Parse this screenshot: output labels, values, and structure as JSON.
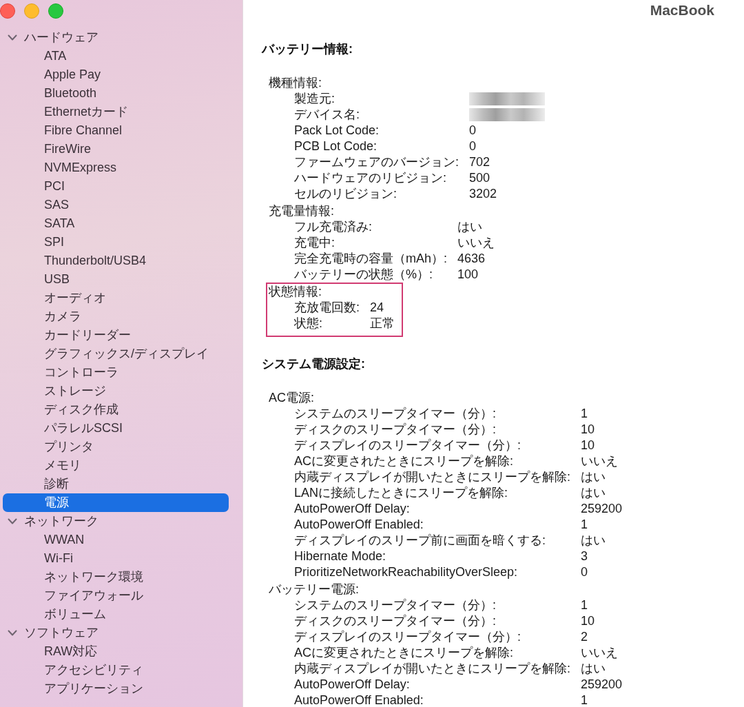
{
  "window": {
    "title": "MacBook",
    "controls": [
      {
        "kind": "close"
      },
      {
        "kind": "minimize"
      },
      {
        "kind": "zoom"
      }
    ]
  },
  "sidebar": {
    "groups": [
      {
        "label": "ハードウェア",
        "expanded": true,
        "children": [
          {
            "label": "ATA",
            "selected": false
          },
          {
            "label": "Apple Pay",
            "selected": false
          },
          {
            "label": "Bluetooth",
            "selected": false
          },
          {
            "label": "Ethernetカード",
            "selected": false
          },
          {
            "label": "Fibre Channel",
            "selected": false
          },
          {
            "label": "FireWire",
            "selected": false
          },
          {
            "label": "NVMExpress",
            "selected": false
          },
          {
            "label": "PCI",
            "selected": false
          },
          {
            "label": "SAS",
            "selected": false
          },
          {
            "label": "SATA",
            "selected": false
          },
          {
            "label": "SPI",
            "selected": false
          },
          {
            "label": "Thunderbolt/USB4",
            "selected": false
          },
          {
            "label": "USB",
            "selected": false
          },
          {
            "label": "オーディオ",
            "selected": false
          },
          {
            "label": "カメラ",
            "selected": false
          },
          {
            "label": "カードリーダー",
            "selected": false
          },
          {
            "label": "グラフィックス/ディスプレイ",
            "selected": false
          },
          {
            "label": "コントローラ",
            "selected": false
          },
          {
            "label": "ストレージ",
            "selected": false
          },
          {
            "label": "ディスク作成",
            "selected": false
          },
          {
            "label": "パラレルSCSI",
            "selected": false
          },
          {
            "label": "プリンタ",
            "selected": false
          },
          {
            "label": "メモリ",
            "selected": false
          },
          {
            "label": "診断",
            "selected": false
          },
          {
            "label": "電源",
            "selected": true
          }
        ]
      },
      {
        "label": "ネットワーク",
        "expanded": true,
        "children": [
          {
            "label": "WWAN",
            "selected": false
          },
          {
            "label": "Wi-Fi",
            "selected": false
          },
          {
            "label": "ネットワーク環境",
            "selected": false
          },
          {
            "label": "ファイアウォール",
            "selected": false
          },
          {
            "label": "ボリューム",
            "selected": false
          }
        ]
      },
      {
        "label": "ソフトウェア",
        "expanded": true,
        "children": [
          {
            "label": "RAW対応",
            "selected": false
          },
          {
            "label": "アクセシビリティ",
            "selected": false
          },
          {
            "label": "アプリケーション",
            "selected": false
          }
        ]
      }
    ]
  },
  "report": {
    "sections": [
      {
        "title": "バッテリー情報:",
        "groups": [
          {
            "label": "機種情報:",
            "highlighted": false,
            "rows": [
              {
                "key": "製造元:",
                "redacted": true
              },
              {
                "key": "デバイス名:",
                "redacted": true
              },
              {
                "key": "Pack Lot Code:",
                "value": "0",
                "redacted": false
              },
              {
                "key": "PCB Lot Code:",
                "value": "0",
                "redacted": false
              },
              {
                "key": "ファームウェアのバージョン:",
                "value": "702",
                "redacted": false
              },
              {
                "key": "ハードウェアのリビジョン:",
                "value": "500",
                "redacted": false
              },
              {
                "key": "セルのリビジョン:",
                "value": "3202",
                "redacted": false
              }
            ]
          },
          {
            "label": "充電量情報:",
            "highlighted": false,
            "rows": [
              {
                "key": "フル充電済み:",
                "value": "はい"
              },
              {
                "key": "充電中:",
                "value": "いいえ"
              },
              {
                "key": "完全充電時の容量（mAh）:",
                "value": "4636"
              },
              {
                "key": "バッテリーの状態（%）:",
                "value": "100"
              }
            ]
          },
          {
            "label": "状態情報:",
            "highlighted": true,
            "rows": [
              {
                "key": "充放電回数:",
                "value": "24"
              },
              {
                "key": "状態:",
                "value": "正常"
              }
            ]
          }
        ]
      },
      {
        "title": "システム電源設定:",
        "groups": [
          {
            "label": "AC電源:",
            "highlighted": false,
            "rows": [
              {
                "key": "システムのスリープタイマー（分）:",
                "value": "1"
              },
              {
                "key": "ディスクのスリープタイマー（分）:",
                "value": "10"
              },
              {
                "key": "ディスプレイのスリープタイマー（分）:",
                "value": "10"
              },
              {
                "key": "ACに変更されたときにスリープを解除:",
                "value": "いいえ"
              },
              {
                "key": "内蔵ディスプレイが開いたときにスリープを解除:",
                "value": "はい"
              },
              {
                "key": "LANに接続したときにスリープを解除:",
                "value": "はい"
              },
              {
                "key": "AutoPowerOff Delay:",
                "value": "259200"
              },
              {
                "key": "AutoPowerOff Enabled:",
                "value": "1"
              },
              {
                "key": "ディスプレイのスリープ前に画面を暗くする:",
                "value": "はい"
              },
              {
                "key": "Hibernate Mode:",
                "value": "3"
              },
              {
                "key": "PrioritizeNetworkReachabilityOverSleep:",
                "value": "0"
              }
            ]
          },
          {
            "label": "バッテリー電源:",
            "highlighted": false,
            "rows": [
              {
                "key": "システムのスリープタイマー（分）:",
                "value": "1"
              },
              {
                "key": "ディスクのスリープタイマー（分）:",
                "value": "10"
              },
              {
                "key": "ディスプレイのスリープタイマー（分）:",
                "value": "2"
              },
              {
                "key": "ACに変更されたときにスリープを解除:",
                "value": "いいえ"
              },
              {
                "key": "内蔵ディスプレイが開いたときにスリープを解除:",
                "value": "はい"
              },
              {
                "key": "AutoPowerOff Delay:",
                "value": "259200"
              },
              {
                "key": "AutoPowerOff Enabled:",
                "value": "1"
              }
            ]
          }
        ]
      }
    ]
  }
}
